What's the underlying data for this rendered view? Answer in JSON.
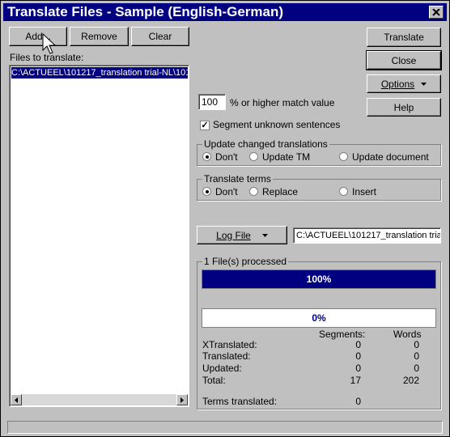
{
  "window": {
    "title": "Translate Files - Sample  (English-German)"
  },
  "buttons": {
    "add": "Add...",
    "remove": "Remove",
    "clear": "Clear",
    "translate": "Translate",
    "close": "Close",
    "options": "Options",
    "help": "Help",
    "logfile": "Log File"
  },
  "files": {
    "label": "Files to translate:",
    "items": [
      "C:\\ACTUEEL\\101217_translation trial-NL\\101"
    ]
  },
  "match": {
    "value": "100",
    "label": "% or higher match value"
  },
  "segment_unknown": {
    "label": "Segment unknown sentences",
    "checked": true
  },
  "update_group": {
    "title": "Update changed translations",
    "options": [
      "Don't",
      "Update TM",
      "Update document"
    ],
    "selected": 0
  },
  "terms_group": {
    "title": "Translate terms",
    "options": [
      "Don't",
      "Replace",
      "Insert"
    ],
    "selected": 0
  },
  "logfile_path": "C:\\ACTUEEL\\101217_translation tria",
  "progress": {
    "title": "1 File(s) processed",
    "bar1": {
      "value": 1.0,
      "text": "100%"
    },
    "bar2": {
      "value": 0.0,
      "text": "0%"
    }
  },
  "stats": {
    "headers": {
      "segments": "Segments:",
      "words": "Words"
    },
    "rows": [
      {
        "label": "XTranslated:",
        "segments": "0",
        "words": "0"
      },
      {
        "label": "Translated:",
        "segments": "0",
        "words": "0"
      },
      {
        "label": "Updated:",
        "segments": "0",
        "words": "0"
      },
      {
        "label": "Total:",
        "segments": "17",
        "words": "202"
      }
    ],
    "terms": {
      "label": "Terms translated:",
      "value": "0"
    }
  },
  "colors": {
    "titlebar": "#000080",
    "selection": "#000080",
    "face": "#c0c0c0"
  }
}
